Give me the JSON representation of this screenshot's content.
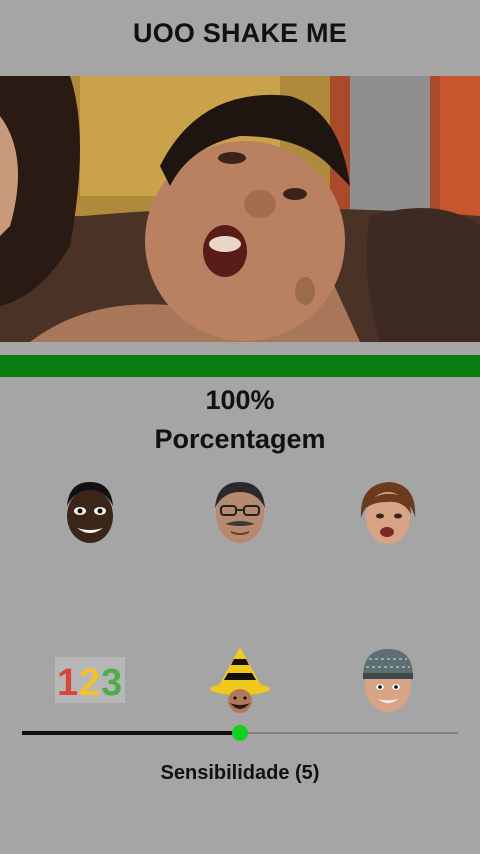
{
  "app": {
    "title": "UOO SHAKE ME"
  },
  "shake": {
    "progress_fraction": 1.0,
    "percent_text": "100%",
    "label": "Porcentagem",
    "bar_color": "#0a7d12"
  },
  "sound_buttons": [
    {
      "name": "sound-button-grinning-man",
      "icon": "grinning-man-face-icon"
    },
    {
      "name": "sound-button-glasses-man",
      "icon": "glasses-man-face-icon"
    },
    {
      "name": "sound-button-woman",
      "icon": "woman-face-icon"
    },
    {
      "name": "sound-button-numbers",
      "icon": "numbers-123-icon",
      "text": "123"
    },
    {
      "name": "sound-button-party-hat",
      "icon": "party-hat-face-icon"
    },
    {
      "name": "sound-button-beanie-man",
      "icon": "beanie-man-face-icon"
    }
  ],
  "sensitivity": {
    "label": "Sensibilidade (5)",
    "value": 5,
    "max": 10,
    "accent": "#16d01f"
  }
}
